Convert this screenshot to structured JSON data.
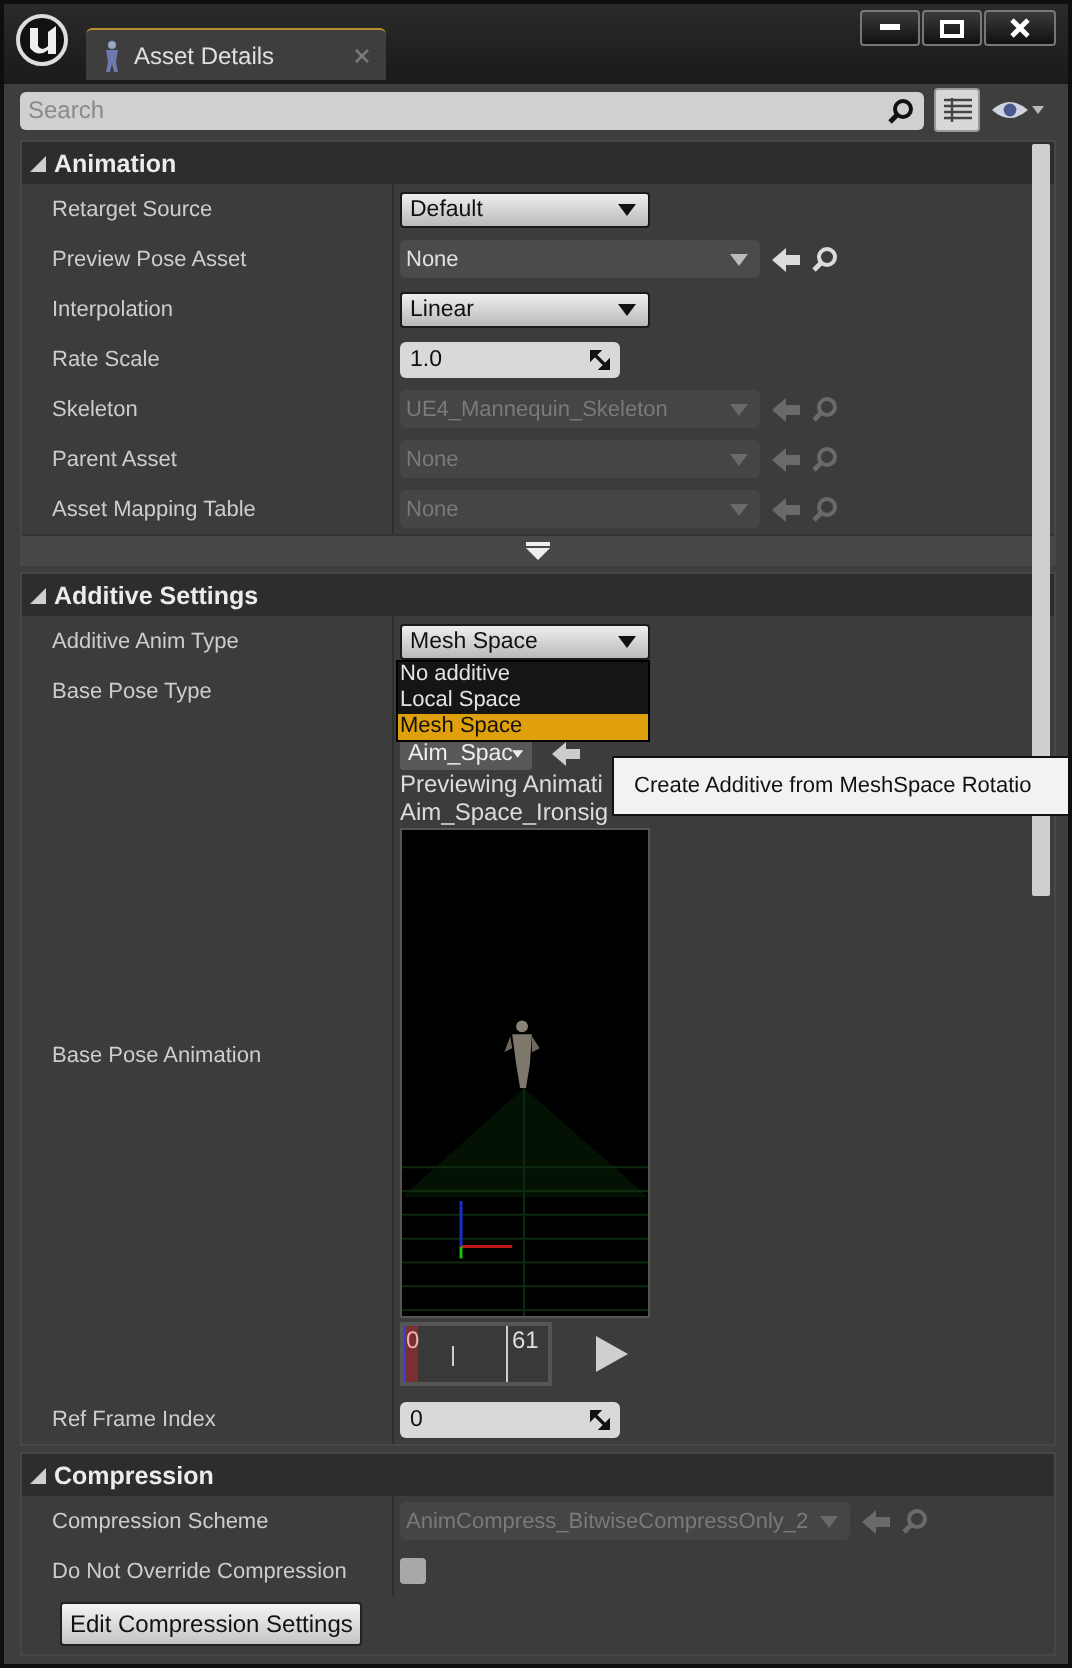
{
  "window": {
    "tab": {
      "title": "Asset Details",
      "selected": true
    }
  },
  "search": {
    "placeholder": "Search"
  },
  "sections": [
    {
      "title": "Animation",
      "expanded": true,
      "advanced_expander": true,
      "rows": [
        {
          "label": "Retarget Source",
          "kind": "combo",
          "value": "Default"
        },
        {
          "label": "Preview Pose Asset",
          "kind": "asset",
          "value": "None",
          "disabled": false
        },
        {
          "label": "Interpolation",
          "kind": "combo",
          "value": "Linear"
        },
        {
          "label": "Rate Scale",
          "kind": "number",
          "value": "1.0"
        },
        {
          "label": "Skeleton",
          "kind": "asset",
          "value": "UE4_Mannequin_Skeleton",
          "disabled": true
        },
        {
          "label": "Parent Asset",
          "kind": "asset",
          "value": "None",
          "disabled": true
        },
        {
          "label": "Asset Mapping Table",
          "kind": "asset",
          "value": "None",
          "disabled": true
        }
      ]
    },
    {
      "title": "Additive Settings",
      "expanded": true,
      "rows": [
        {
          "label": "Additive Anim Type",
          "kind": "combo",
          "value": "Mesh Space",
          "open": true,
          "options": [
            {
              "label": "No additive",
              "selected": false
            },
            {
              "label": "Local Space",
              "selected": false
            },
            {
              "label": "Mesh Space",
              "selected": true
            }
          ]
        },
        {
          "label": "Base Pose Type",
          "kind": "covered"
        },
        {
          "label": "Base Pose Animation",
          "kind": "anim_preview",
          "value": "Aim_Spac",
          "preview_lines": [
            "Previewing Animati",
            "Aim_Space_Ironsig"
          ],
          "timeline": {
            "start": "0",
            "end": "61"
          }
        },
        {
          "label": "Ref Frame Index",
          "kind": "number",
          "value": "0"
        }
      ]
    },
    {
      "title": "Compression",
      "expanded": true,
      "rows": [
        {
          "label": "Compression Scheme",
          "kind": "asset",
          "value": "AnimCompress_BitwiseCompressOnly_2",
          "disabled": true
        },
        {
          "label": "Do Not Override Compression",
          "kind": "checkbox",
          "checked": false
        }
      ],
      "buttons": [
        "Edit Compression Settings"
      ]
    }
  ],
  "tooltip": {
    "text": "Create Additive from MeshSpace Rotatio"
  }
}
